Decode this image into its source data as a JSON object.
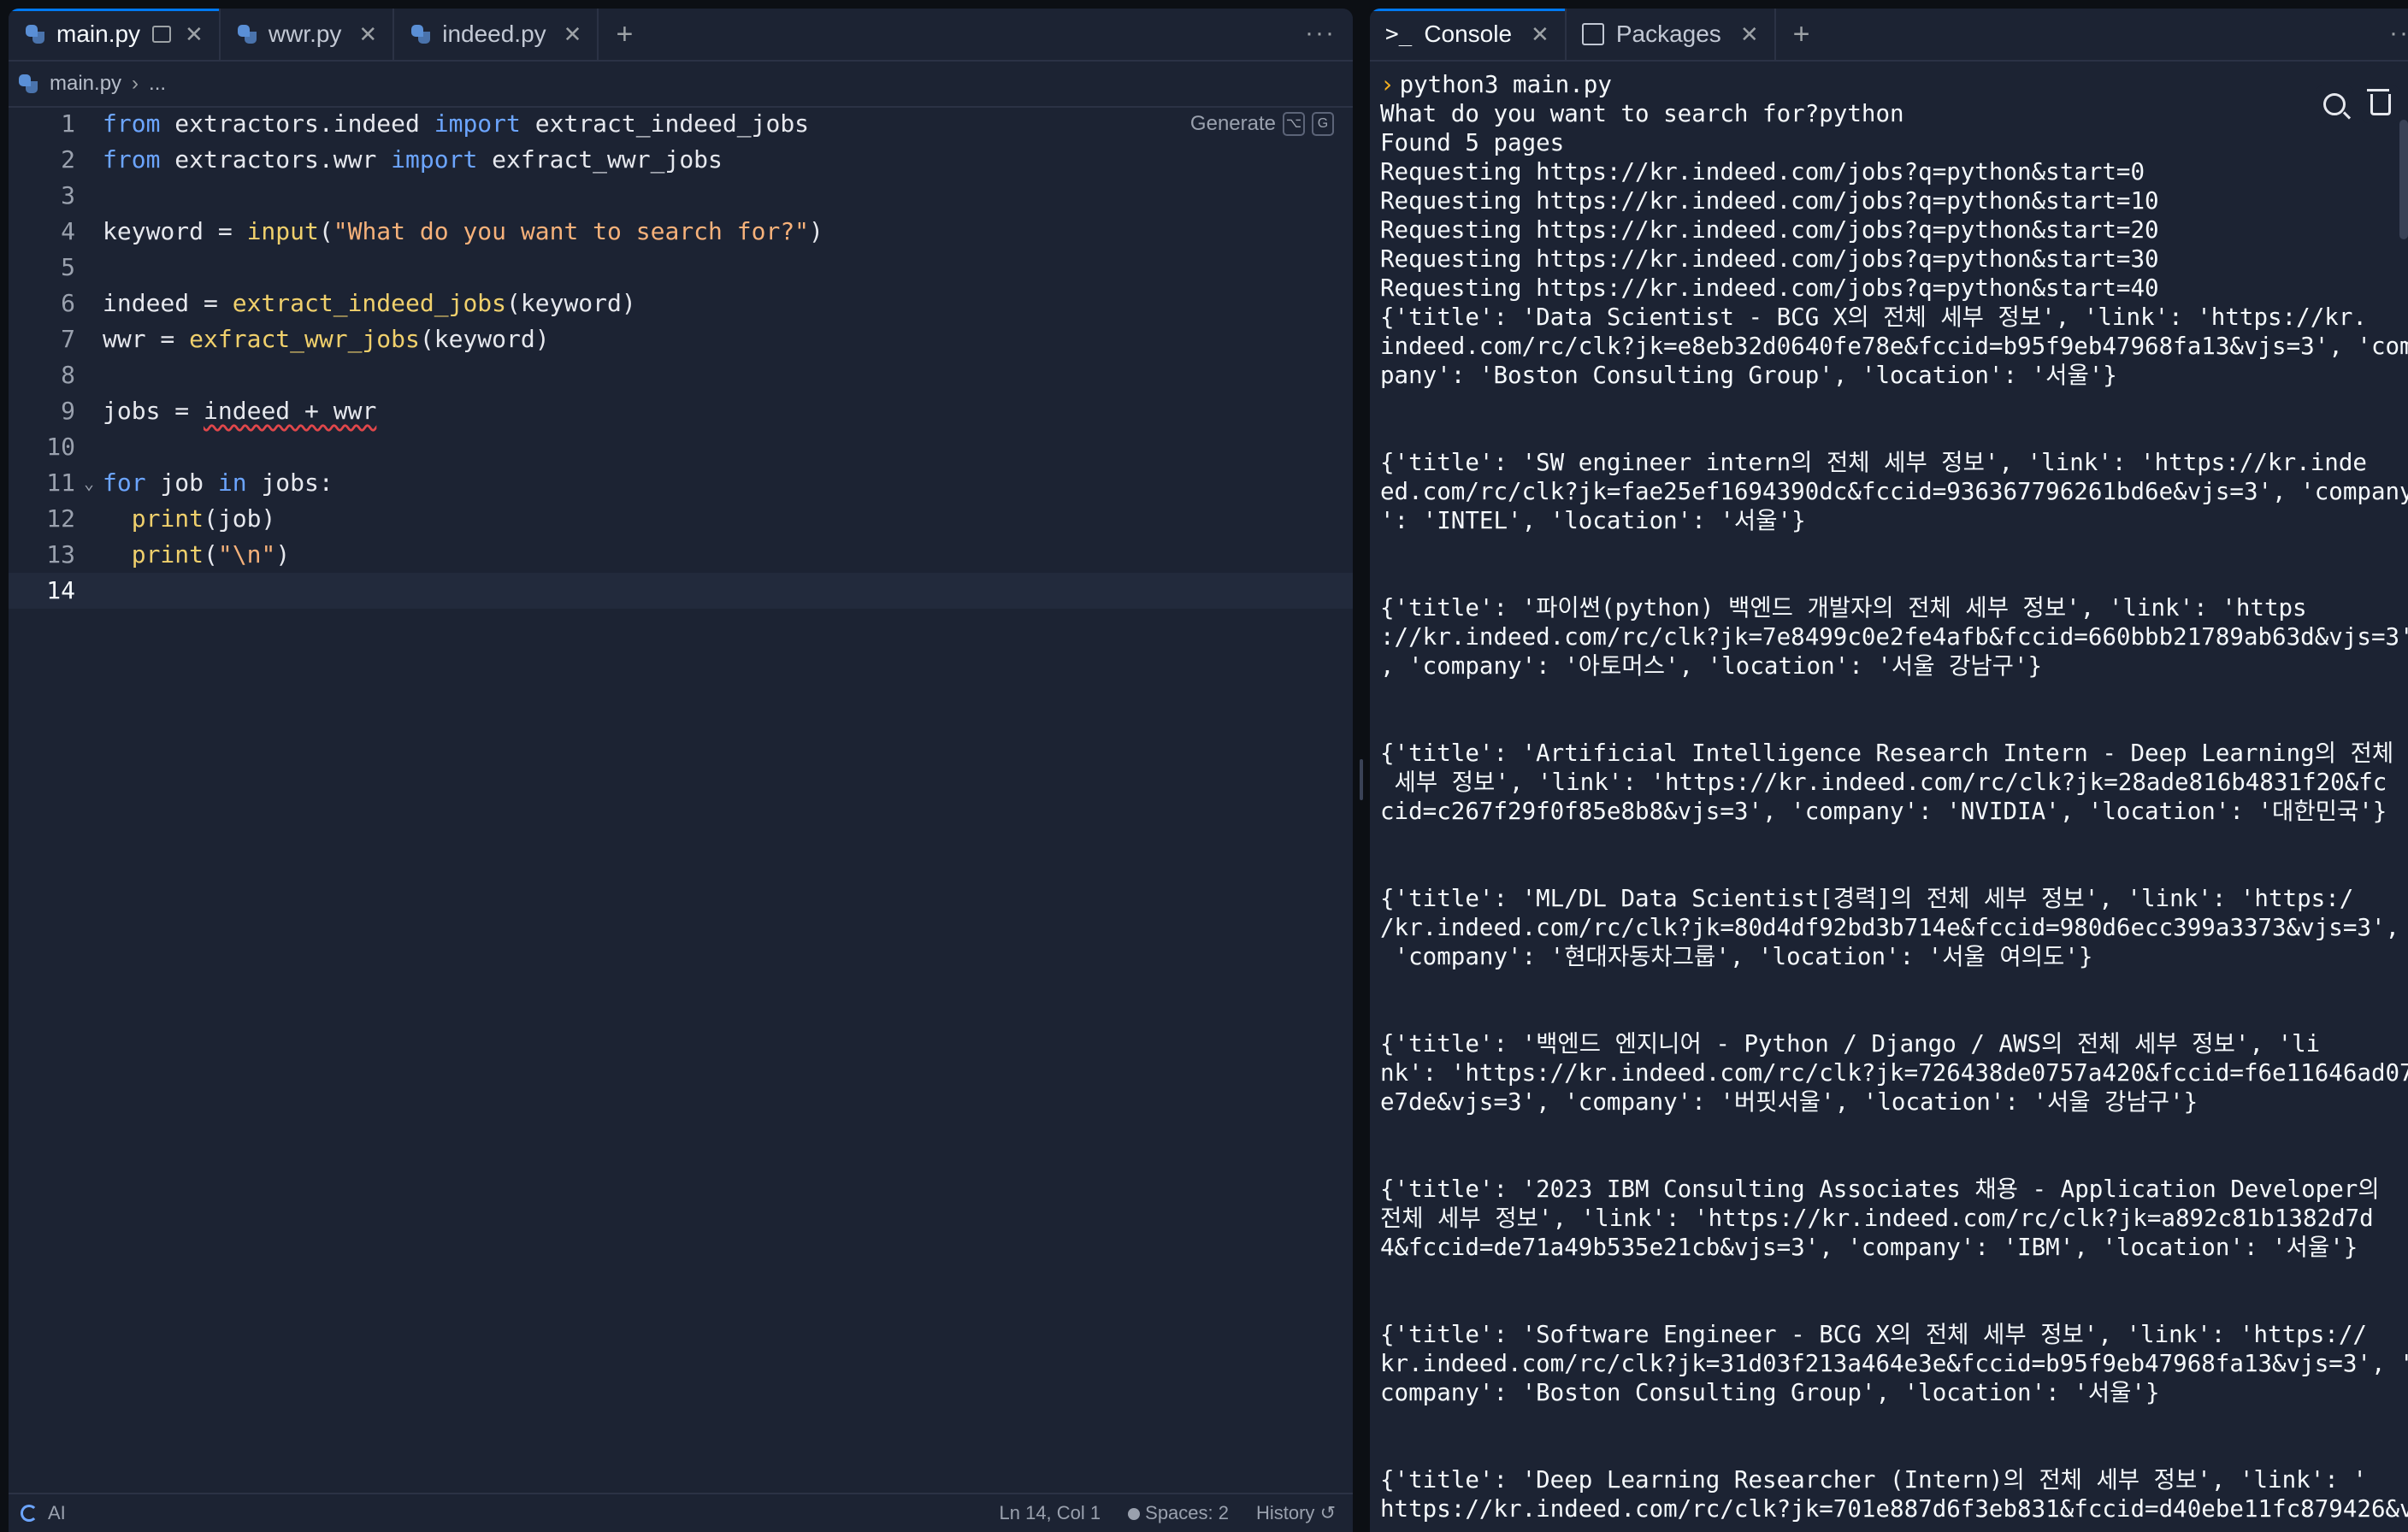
{
  "editor": {
    "tabs": [
      {
        "label": "main.py",
        "active": true
      },
      {
        "label": "wwr.py",
        "active": false
      },
      {
        "label": "indeed.py",
        "active": false
      }
    ],
    "breadcrumb": {
      "file": "main.py",
      "rest": "..."
    },
    "generate_label": "Generate",
    "generate_keys": [
      "⌥",
      "G"
    ],
    "status": {
      "ai": "AI",
      "position": "Ln 14, Col 1",
      "spaces": "Spaces: 2",
      "history": "History"
    }
  },
  "code_lines": [
    {
      "n": "1",
      "tokens": [
        [
          "kw",
          "from"
        ],
        [
          "",
          " extractors.indeed "
        ],
        [
          "kw",
          "import"
        ],
        [
          "",
          " extract_indeed_jobs"
        ]
      ]
    },
    {
      "n": "2",
      "tokens": [
        [
          "kw",
          "from"
        ],
        [
          "",
          " extractors.wwr "
        ],
        [
          "kw",
          "import"
        ],
        [
          "",
          " exfract_wwr_jobs"
        ]
      ]
    },
    {
      "n": "3",
      "tokens": []
    },
    {
      "n": "4",
      "tokens": [
        [
          "",
          "keyword = "
        ],
        [
          "fn",
          "input"
        ],
        [
          "",
          "("
        ],
        [
          "str",
          "\"What do you want to search for?\""
        ],
        [
          "",
          ")"
        ]
      ]
    },
    {
      "n": "5",
      "tokens": []
    },
    {
      "n": "6",
      "tokens": [
        [
          "",
          "indeed = "
        ],
        [
          "fn",
          "extract_indeed_jobs"
        ],
        [
          "",
          "(keyword)"
        ]
      ]
    },
    {
      "n": "7",
      "tokens": [
        [
          "",
          "wwr = "
        ],
        [
          "fn",
          "exfract_wwr_jobs"
        ],
        [
          "",
          "(keyword)"
        ]
      ]
    },
    {
      "n": "8",
      "tokens": []
    },
    {
      "n": "9",
      "tokens": [
        [
          "",
          "jobs = "
        ],
        [
          "squiggle",
          "indeed + wwr"
        ]
      ]
    },
    {
      "n": "10",
      "tokens": []
    },
    {
      "n": "11",
      "tokens": [
        [
          "kw",
          "for"
        ],
        [
          "",
          " job "
        ],
        [
          "kw",
          "in"
        ],
        [
          "",
          " jobs:"
        ]
      ],
      "fold": true
    },
    {
      "n": "12",
      "tokens": [
        [
          "",
          "  "
        ],
        [
          "fn",
          "print"
        ],
        [
          "",
          "(job)"
        ]
      ]
    },
    {
      "n": "13",
      "tokens": [
        [
          "",
          "  "
        ],
        [
          "fn",
          "print"
        ],
        [
          "",
          "("
        ],
        [
          "str",
          "\"\\n\""
        ],
        [
          "",
          ")"
        ]
      ]
    },
    {
      "n": "14",
      "tokens": [],
      "current": true
    }
  ],
  "console": {
    "tabs": [
      {
        "label": "Console",
        "active": true
      },
      {
        "label": "Packages",
        "active": false
      }
    ],
    "command": "python3 main.py",
    "lines": [
      "What do you want to search for?python",
      "Found 5 pages",
      "Requesting https://kr.indeed.com/jobs?q=python&start=0",
      "Requesting https://kr.indeed.com/jobs?q=python&start=10",
      "Requesting https://kr.indeed.com/jobs?q=python&start=20",
      "Requesting https://kr.indeed.com/jobs?q=python&start=30",
      "Requesting https://kr.indeed.com/jobs?q=python&start=40",
      "{'title': 'Data Scientist - BCG X의 전체 세부 정보', 'link': 'https://kr.",
      "indeed.com/rc/clk?jk=e8eb32d0640fe78e&fccid=b95f9eb47968fa13&vjs=3', 'com",
      "pany': 'Boston Consulting Group', 'location': '서울'}",
      "",
      "",
      "{'title': 'SW engineer intern의 전체 세부 정보', 'link': 'https://kr.inde",
      "ed.com/rc/clk?jk=fae25ef1694390dc&fccid=936367796261bd6e&vjs=3', 'company",
      "': 'INTEL', 'location': '서울'}",
      "",
      "",
      "{'title': '파이썬(python) 백엔드 개발자의 전체 세부 정보', 'link': 'https",
      "://kr.indeed.com/rc/clk?jk=7e8499c0e2fe4afb&fccid=660bbb21789ab63d&vjs=3'",
      ", 'company': '아토머스', 'location': '서울 강남구'}",
      "",
      "",
      "{'title': 'Artificial Intelligence Research Intern - Deep Learning의 전체",
      " 세부 정보', 'link': 'https://kr.indeed.com/rc/clk?jk=28ade816b4831f20&fc",
      "cid=c267f29f0f85e8b8&vjs=3', 'company': 'NVIDIA', 'location': '대한민국'}",
      "",
      "",
      "{'title': 'ML/DL Data Scientist[경력]의 전체 세부 정보', 'link': 'https:/",
      "/kr.indeed.com/rc/clk?jk=80d4df92bd3b714e&fccid=980d6ecc399a3373&vjs=3',",
      " 'company': '현대자동차그룹', 'location': '서울 여의도'}",
      "",
      "",
      "{'title': '백엔드 엔지니어 - Python / Django / AWS의 전체 세부 정보', 'li",
      "nk': 'https://kr.indeed.com/rc/clk?jk=726438de0757a420&fccid=f6e11646ad07",
      "e7de&vjs=3', 'company': '버핏서울', 'location': '서울 강남구'}",
      "",
      "",
      "{'title': '2023 IBM Consulting Associates 채용 - Application Developer의",
      "전체 세부 정보', 'link': 'https://kr.indeed.com/rc/clk?jk=a892c81b1382d7d",
      "4&fccid=de71a49b535e21cb&vjs=3', 'company': 'IBM', 'location': '서울'}",
      "",
      "",
      "{'title': 'Software Engineer - BCG X의 전체 세부 정보', 'link': 'https://",
      "kr.indeed.com/rc/clk?jk=31d03f213a464e3e&fccid=b95f9eb47968fa13&vjs=3', '",
      "company': 'Boston Consulting Group', 'location': '서울'}",
      "",
      "",
      "{'title': 'Deep Learning Researcher (Intern)의 전체 세부 정보', 'link': '",
      "https://kr.indeed.com/rc/clk?jk=701e887d6f3eb831&fccid=d40ebe11fc879426&v"
    ]
  }
}
